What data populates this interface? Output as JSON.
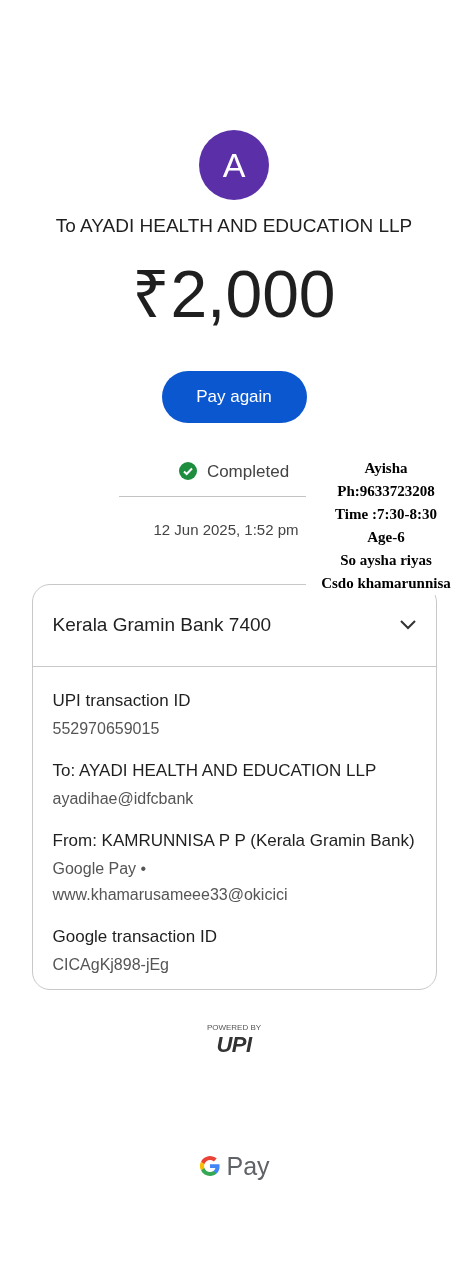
{
  "payee": {
    "avatar_letter": "A",
    "title": "To AYADI HEALTH AND EDUCATION LLP"
  },
  "amount": "₹2,000",
  "pay_again_button": "Pay again",
  "status": {
    "label": "Completed",
    "completed": true,
    "date": "12 Jun 2025, 1:52 pm"
  },
  "annotation": [
    "Ayisha",
    "Ph:9633723208",
    "Time :7:30-8:30",
    "Age-6",
    "So aysha riyas",
    "Csdo khamarunnisa"
  ],
  "card": {
    "bank": "Kerala Gramin Bank 7400",
    "expanded": true,
    "details": [
      {
        "label": "UPI transaction ID",
        "values": [
          "552970659015"
        ]
      },
      {
        "label": "To: AYADI HEALTH AND EDUCATION LLP",
        "values": [
          "ayadihae@idfcbank"
        ]
      },
      {
        "label": "From: KAMRUNNISA P P (Kerala Gramin Bank)",
        "values": [
          "Google Pay •",
          "www.khamarusameee33@okicici"
        ]
      },
      {
        "label": "Google transaction ID",
        "values": [
          "CICAgKj898-jEg"
        ]
      }
    ]
  },
  "footer": {
    "powered_by": "POWERED BY",
    "upi_logo": "UPI",
    "brand": "Pay"
  }
}
